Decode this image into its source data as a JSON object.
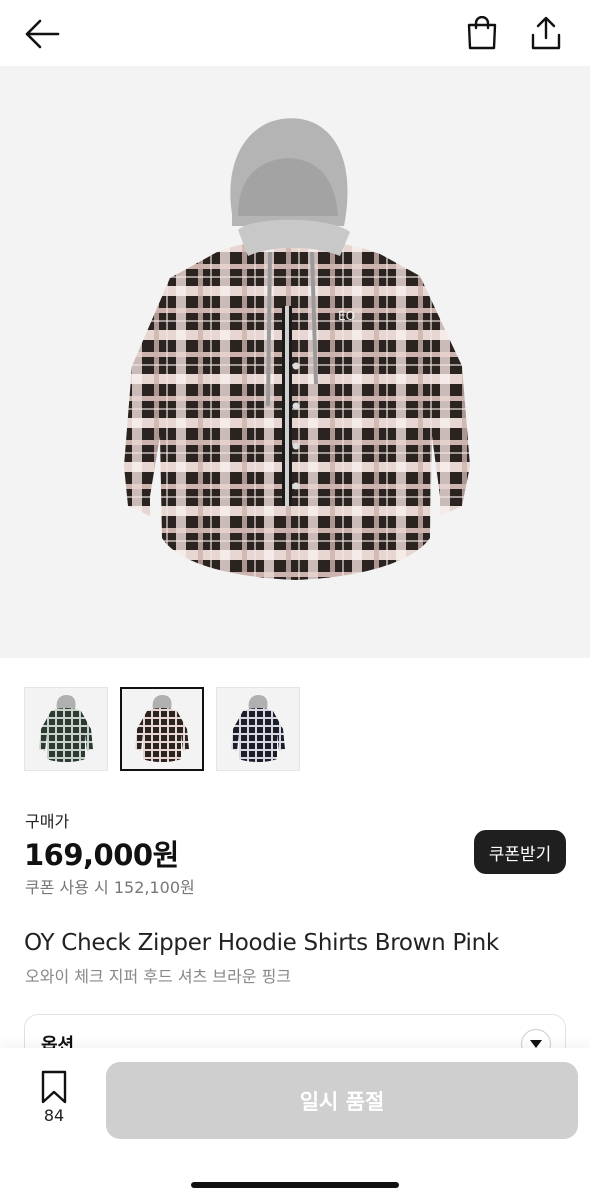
{
  "header": {
    "back_icon": "arrow-left-icon",
    "bag_icon": "shopping-bag-icon",
    "share_icon": "share-icon"
  },
  "product": {
    "image_alt_icon": "product-photo",
    "thumbnails": [
      {
        "variant": "green",
        "selected": false
      },
      {
        "variant": "brown-pink",
        "selected": true
      },
      {
        "variant": "navy",
        "selected": false
      }
    ],
    "price_label": "구매가",
    "price": "169,000원",
    "coupon_price": "쿠폰 사용 시 152,100원",
    "coupon_button": "쿠폰받기",
    "title_en": "OY Check Zipper Hoodie Shirts Brown Pink",
    "title_ko": "오와이 체크 지퍼 후드 셔츠 브라운 핑크"
  },
  "options": {
    "label": "옵션"
  },
  "bottom": {
    "wish_count": "84",
    "soldout_label": "일시 품절"
  },
  "colors": {
    "accent_dark": "#1f1f1f",
    "disabled": "#cfcfcf",
    "image_bg": "#f3f3f3"
  }
}
